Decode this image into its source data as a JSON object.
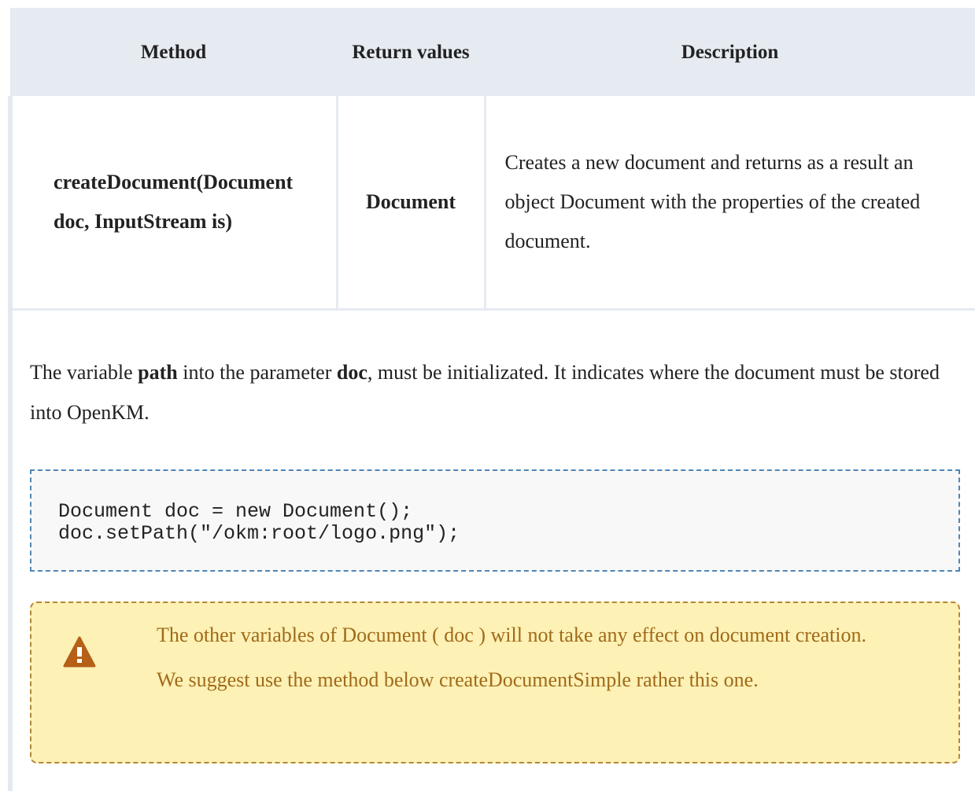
{
  "table": {
    "headers": {
      "method": "Method",
      "return_values": "Return values",
      "description": "Description"
    },
    "rows": [
      {
        "method": "createDocument(Document doc, InputStream is)",
        "return_value": "Document",
        "description": "Creates a new document and returns as a result an object Document with the properties of the created document."
      }
    ]
  },
  "note": {
    "part1": "The variable ",
    "path_term": "path",
    "part2": " into the parameter ",
    "doc_term": "doc",
    "part3": ", must be initializated. It indicates where the document must be stored into OpenKM."
  },
  "code": {
    "line1": "Document doc = new Document();",
    "line2": "doc.setPath(\"/okm:root/logo.png\");"
  },
  "warning": {
    "icon": "warning-icon",
    "text1": "The other variables of Document ( doc ) will not take any effect on document creation.",
    "text2": "We suggest use the method below createDocumentSimple rather this one.",
    "color": "#a06a1a",
    "background": "#fdf1b5"
  }
}
